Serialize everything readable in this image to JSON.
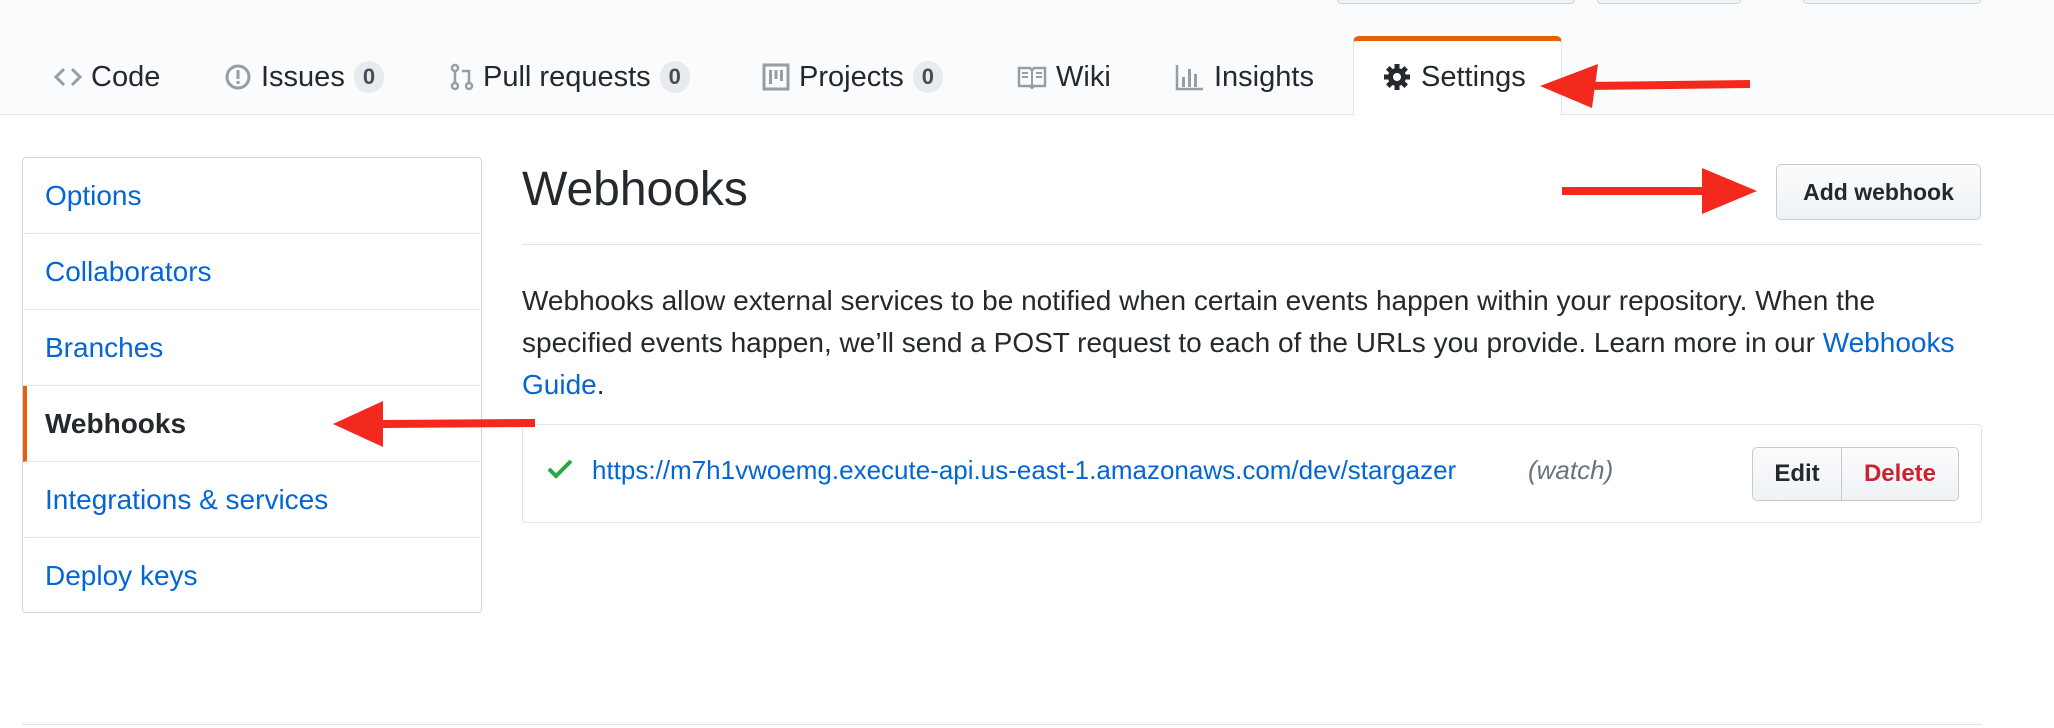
{
  "tabs": [
    {
      "label": "Code",
      "count": null
    },
    {
      "label": "Issues",
      "count": "0"
    },
    {
      "label": "Pull requests",
      "count": "0"
    },
    {
      "label": "Projects",
      "count": "0"
    },
    {
      "label": "Wiki",
      "count": null
    },
    {
      "label": "Insights",
      "count": null
    },
    {
      "label": "Settings",
      "count": null,
      "selected": true
    }
  ],
  "sidebar": {
    "items": [
      {
        "label": "Options"
      },
      {
        "label": "Collaborators"
      },
      {
        "label": "Branches"
      },
      {
        "label": "Webhooks",
        "selected": true
      },
      {
        "label": "Integrations & services"
      },
      {
        "label": "Deploy keys"
      }
    ]
  },
  "main": {
    "title": "Webhooks",
    "add_button": "Add webhook",
    "description": "Webhooks allow external services to be notified when certain events happen within your repository. When the specified events happen, we’ll send a POST request to each of the URLs you provide. Learn more in our",
    "guide_link": "Webhooks Guide",
    "guide_suffix": ".",
    "hook": {
      "url": "https://m7h1vwoemg.execute-api.us-east-1.amazonaws.com/dev/stargazer",
      "events": "(watch)",
      "status_icon": "check-icon",
      "edit_label": "Edit",
      "delete_label": "Delete"
    }
  },
  "colors": {
    "accent": "#e36209",
    "link": "#0366d6",
    "danger": "#cb2431",
    "success": "#28a745",
    "annotation_arrow": "#f2291c"
  }
}
